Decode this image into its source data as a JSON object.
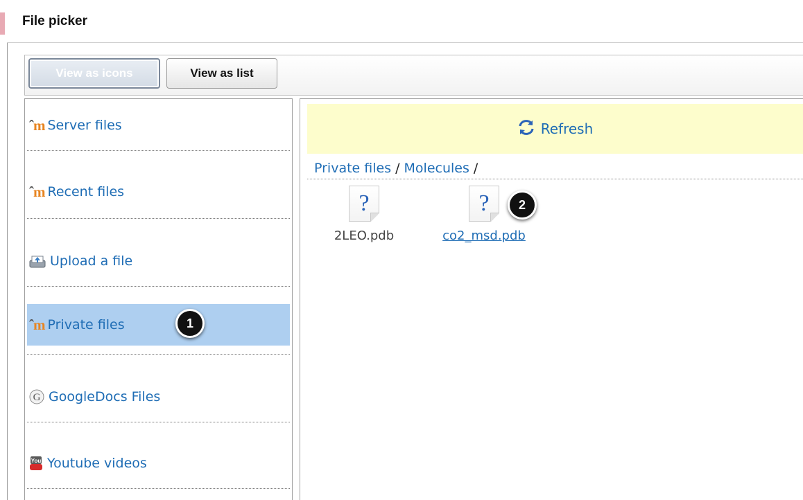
{
  "dialog": {
    "title": "File picker"
  },
  "toolbar": {
    "view_icons_label": "View as icons",
    "view_list_label": "View as list"
  },
  "sidebar": {
    "items": [
      {
        "label": "Server files",
        "icon": "moodle-icon"
      },
      {
        "label": "Recent files",
        "icon": "moodle-icon"
      },
      {
        "label": "Upload a file",
        "icon": "upload-icon"
      },
      {
        "label": "Private files",
        "icon": "moodle-icon",
        "selected": true
      },
      {
        "label": "GoogleDocs Files",
        "icon": "google-icon"
      },
      {
        "label": "Youtube videos",
        "icon": "youtube-icon"
      }
    ]
  },
  "content": {
    "refresh_label": "Refresh",
    "breadcrumb": [
      "Private files",
      "Molecules"
    ],
    "breadcrumb_separator": "/",
    "files": [
      {
        "name": "2LEO.pdb",
        "icon": "unknown-file-icon"
      },
      {
        "name": "co2_msd.pdb",
        "icon": "unknown-file-icon",
        "hovered": true
      }
    ]
  },
  "callouts": [
    "1",
    "2"
  ],
  "colors": {
    "link": "#1f6db5",
    "selected_bg": "#aecff0",
    "refresh_bg": "#fdfdcc",
    "moodle_orange": "#e78522"
  }
}
